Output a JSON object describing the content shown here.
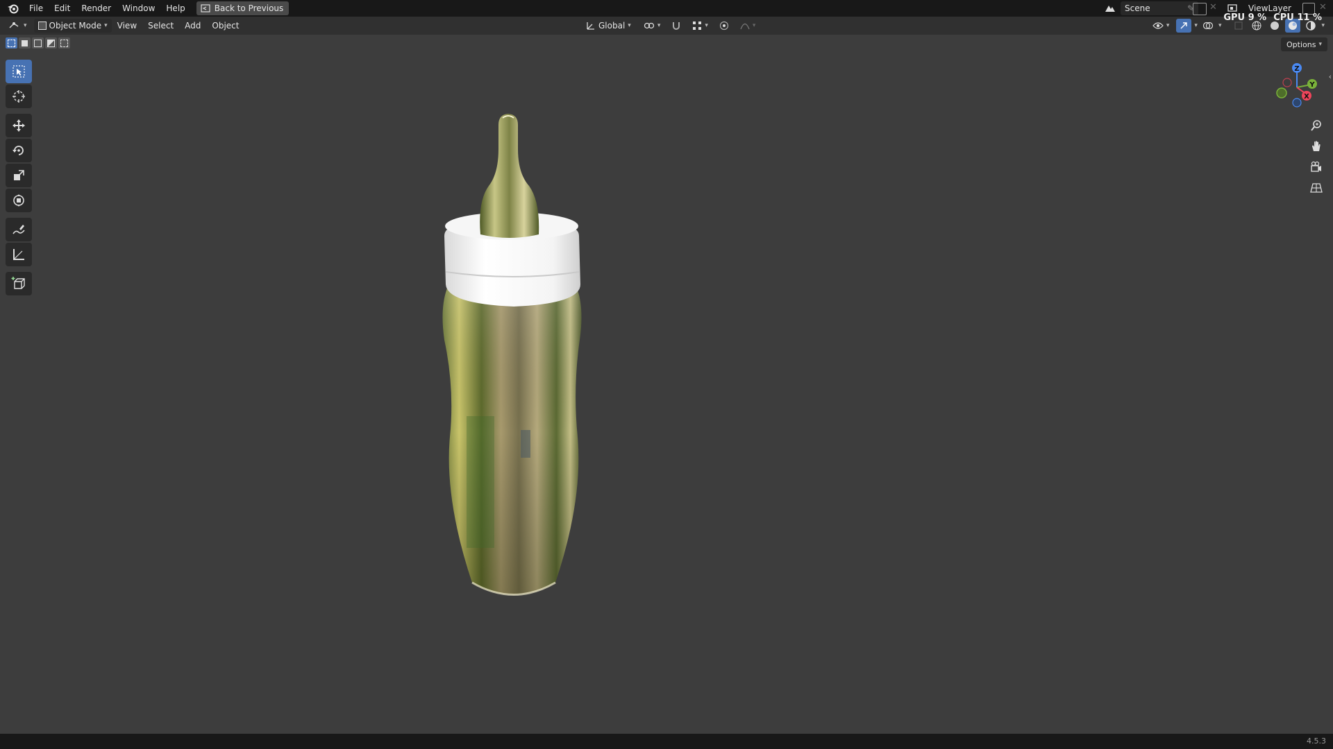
{
  "menubar": {
    "items": [
      "File",
      "Edit",
      "Render",
      "Window",
      "Help"
    ],
    "back_button": "Back to Previous"
  },
  "scene": {
    "name": "Scene"
  },
  "view_layer": {
    "name": "ViewLayer"
  },
  "header": {
    "mode": "Object Mode",
    "menus": [
      "View",
      "Select",
      "Add",
      "Object"
    ],
    "transform_orientation": "Global"
  },
  "options": {
    "label": "Options"
  },
  "stats": {
    "gpu": "GPU 9 %",
    "cpu": "CPU 11 %"
  },
  "gizmo": {
    "x": "X",
    "y": "Y",
    "z": "Z"
  },
  "status": {
    "version": "4.5.3"
  },
  "tools": [
    "select-box",
    "cursor",
    "move",
    "rotate",
    "scale",
    "transform",
    "annotate",
    "measure",
    "add-cube"
  ],
  "colors": {
    "accent": "#4772b3",
    "background": "#3d3d3d",
    "topbar": "#181818",
    "header": "#303030"
  }
}
